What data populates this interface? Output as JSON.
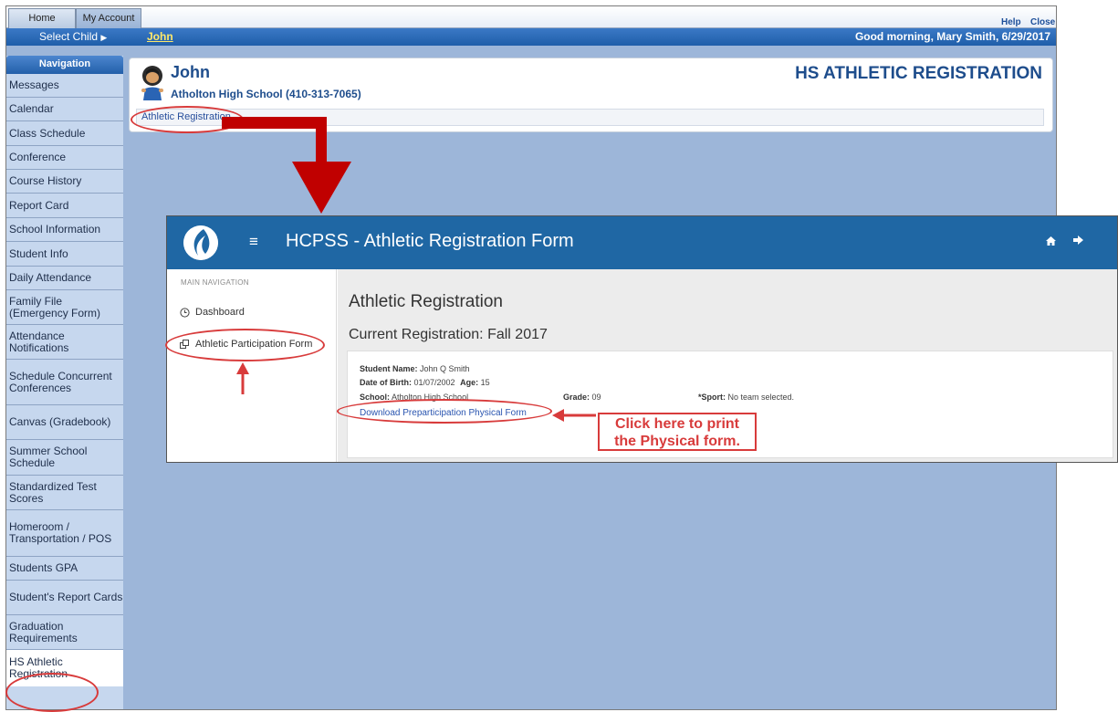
{
  "portal": {
    "tabs": [
      {
        "label": "Home"
      },
      {
        "label": "My Account"
      }
    ],
    "help_label": "Help",
    "close_label": "Close",
    "select_child_label": "Select Child",
    "select_child_arrow": "▶",
    "child_name": "John",
    "greeting": "Good morning, Mary Smith, 6/29/2017",
    "nav_header": "Navigation",
    "nav_items": [
      {
        "label": "Messages"
      },
      {
        "label": "Calendar"
      },
      {
        "label": "Class Schedule"
      },
      {
        "label": "Conference"
      },
      {
        "label": "Course History"
      },
      {
        "label": "Report Card"
      },
      {
        "label": "School Information"
      },
      {
        "label": "Student Info"
      },
      {
        "label": "Daily Attendance"
      },
      {
        "label": "Family File (Emergency Form)"
      },
      {
        "label": "Attendance Notifications"
      },
      {
        "label": "Schedule Concurrent Conferences"
      },
      {
        "label": "Canvas (Gradebook)"
      },
      {
        "label": "Summer School Schedule"
      },
      {
        "label": "Standardized Test Scores"
      },
      {
        "label": "Homeroom / Transportation / POS"
      },
      {
        "label": "Students GPA"
      },
      {
        "label": "Student's Report Cards"
      },
      {
        "label": "Graduation Requirements"
      },
      {
        "label": "HS Athletic Registration"
      }
    ],
    "student": {
      "name": "John",
      "school": "Atholton High School (410-313-7065)",
      "avatar_icon": "student-avatar-icon"
    },
    "page_title": "HS ATHLETIC REGISTRATION",
    "breadcrumb": "Athletic Registration"
  },
  "hcpss": {
    "menu_icon": "≡",
    "title": "HCPSS - Athletic Registration Form",
    "home_icon": "home-icon",
    "signout_icon": "sign-out-icon",
    "main_nav_label": "MAIN NAVIGATION",
    "nav": [
      {
        "label": "Dashboard",
        "icon": "clock-icon"
      },
      {
        "label": "Athletic Participation Form",
        "icon": "external-window-icon"
      }
    ],
    "heading": "Athletic Registration",
    "subheading": "Current Registration: Fall 2017",
    "student_name_label": "Student Name:",
    "student_name": "John Q Smith",
    "dob_label": "Date of Birth:",
    "dob": "01/07/2002",
    "age_label": "Age:",
    "age": "15",
    "school_label": "School:",
    "school": "Atholton High School",
    "grade_label": "Grade:",
    "grade": "09",
    "sport_label": "*Sport:",
    "sport": "No team selected.",
    "download_link": "Download Preparticipation Physical Form"
  },
  "annotations": {
    "callout_line1": "Click here to print",
    "callout_line2": "the Physical form.",
    "color": "#d83b3b",
    "big_arrow_color": "#c00000"
  }
}
